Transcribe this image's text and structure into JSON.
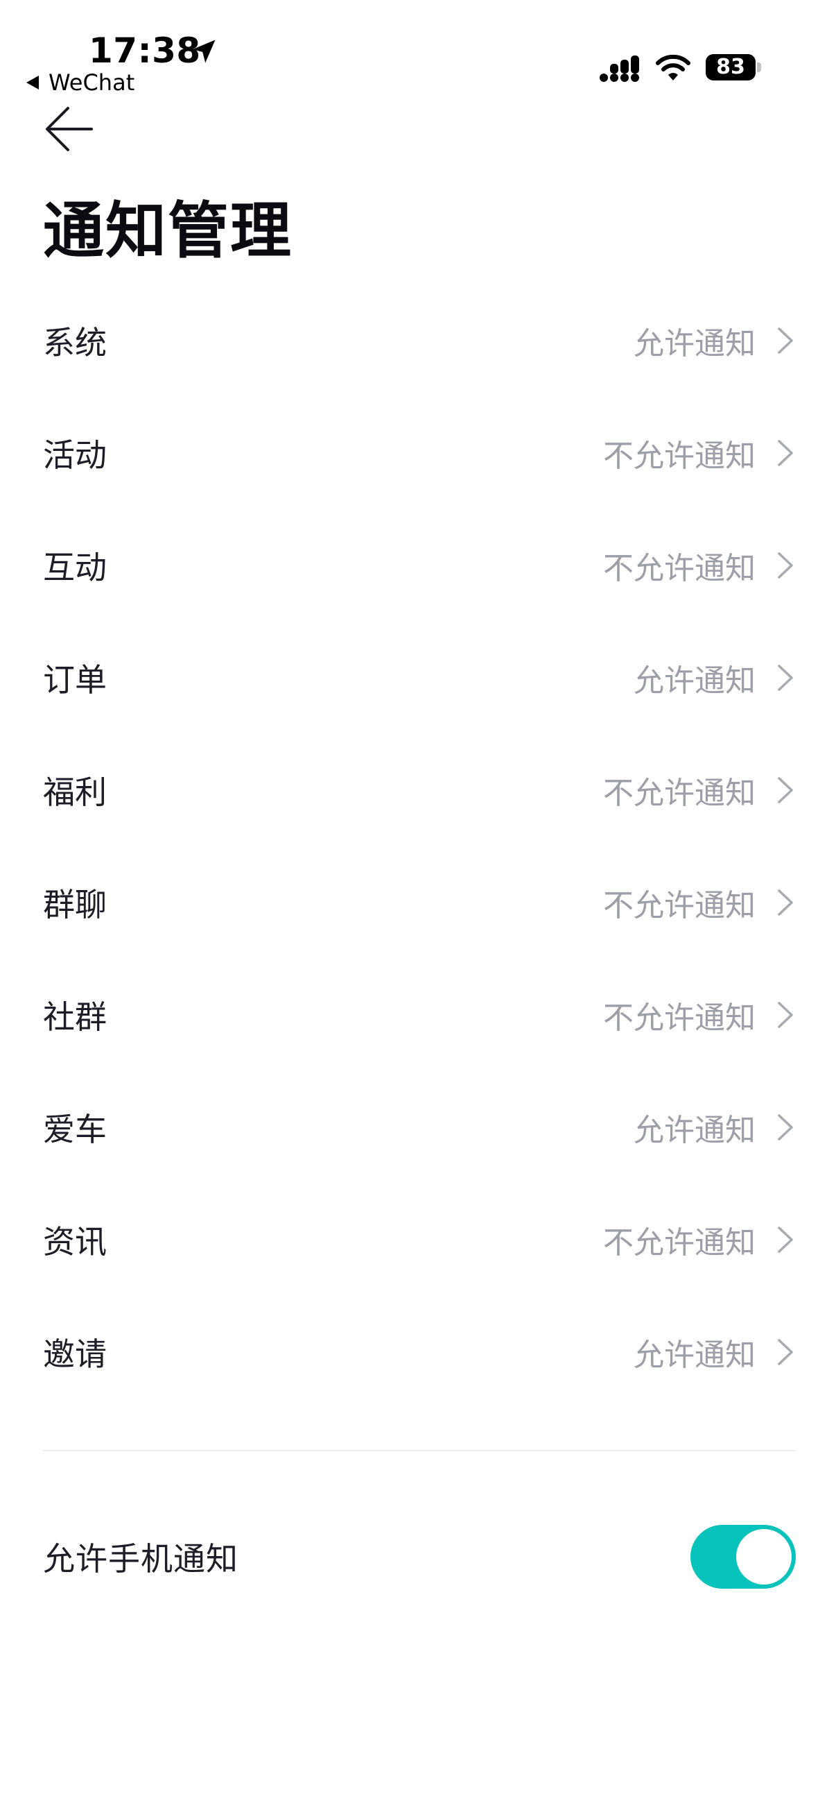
{
  "status_bar": {
    "time": "17:38",
    "back_app": "WeChat",
    "battery": "83",
    "icons": [
      "location-arrow-icon",
      "signal-icon",
      "wifi-icon",
      "battery-icon"
    ]
  },
  "nav": {
    "back_icon": "arrow-left-icon",
    "title": "通知管理"
  },
  "settings": [
    {
      "label": "系统",
      "value": "允许通知"
    },
    {
      "label": "活动",
      "value": "不允许通知"
    },
    {
      "label": "互动",
      "value": "不允许通知"
    },
    {
      "label": "订单",
      "value": "允许通知"
    },
    {
      "label": "福利",
      "value": "不允许通知"
    },
    {
      "label": "群聊",
      "value": "不允许通知"
    },
    {
      "label": "社群",
      "value": "不允许通知"
    },
    {
      "label": "爱车",
      "value": "允许通知"
    },
    {
      "label": "资讯",
      "value": "不允许通知"
    },
    {
      "label": "邀请",
      "value": "允许通知"
    }
  ],
  "phone_notification": {
    "label": "允许手机通知",
    "enabled": true
  },
  "colors": {
    "toggle_on": "#08c2bc",
    "value_text": "#9c9ea8",
    "label_text": "#1c1d26"
  }
}
